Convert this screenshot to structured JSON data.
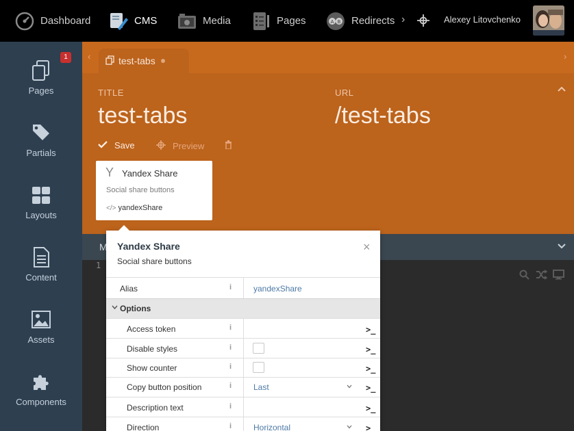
{
  "topbar": {
    "nav": [
      {
        "label": "Dashboard",
        "icon": "dashboard-gauge-icon"
      },
      {
        "label": "CMS",
        "icon": "cms-icon",
        "active": true
      },
      {
        "label": "Media",
        "icon": "media-icon"
      },
      {
        "label": "Pages",
        "icon": "pages-icon"
      },
      {
        "label": "Redirects",
        "icon": "redirects-icon"
      }
    ],
    "more_icon": "chevron-right-icon",
    "move_icon": "move-arrows-icon",
    "user_name": "Alexey Litovchenko"
  },
  "sidebar": {
    "items": [
      {
        "label": "Pages",
        "icon": "pages-icon",
        "badge": "1"
      },
      {
        "label": "Partials",
        "icon": "tags-icon"
      },
      {
        "label": "Layouts",
        "icon": "layout-grid-icon"
      },
      {
        "label": "Content",
        "icon": "file-text-icon"
      },
      {
        "label": "Assets",
        "icon": "image-icon"
      },
      {
        "label": "Components",
        "icon": "puzzle-icon"
      }
    ]
  },
  "tab": {
    "label": "test-tabs"
  },
  "form": {
    "title_label": "TITLE",
    "title_value": "test-tabs",
    "url_label": "URL",
    "url_value": "/test-tabs"
  },
  "toolbar": {
    "save": "Save",
    "preview": "Preview"
  },
  "component_card": {
    "name": "Yandex Share",
    "description": "Social share buttons",
    "alias": "yandexShare"
  },
  "editor": {
    "tab_label": "M",
    "line_number": "1"
  },
  "inspector": {
    "title": "Yandex Share",
    "subtitle": "Social share buttons",
    "alias_label": "Alias",
    "alias_value": "yandexShare",
    "group_label": "Options",
    "properties": [
      {
        "name": "Access token",
        "type": "text",
        "value": ""
      },
      {
        "name": "Disable styles",
        "type": "checkbox",
        "value": ""
      },
      {
        "name": "Show counter",
        "type": "checkbox",
        "value": ""
      },
      {
        "name": "Copy button position",
        "type": "select",
        "value": "Last"
      },
      {
        "name": "Description text",
        "type": "text",
        "value": ""
      },
      {
        "name": "Direction",
        "type": "select",
        "value": "Horizontal"
      }
    ],
    "info_glyph": "i",
    "terminal_glyph": ">_"
  },
  "colors": {
    "topbar": "#000000",
    "sidebar": "#2e3f50",
    "header_orange": "#bc631c",
    "tabstrip_orange": "#c86a1e",
    "link_blue": "#4d79a6"
  }
}
